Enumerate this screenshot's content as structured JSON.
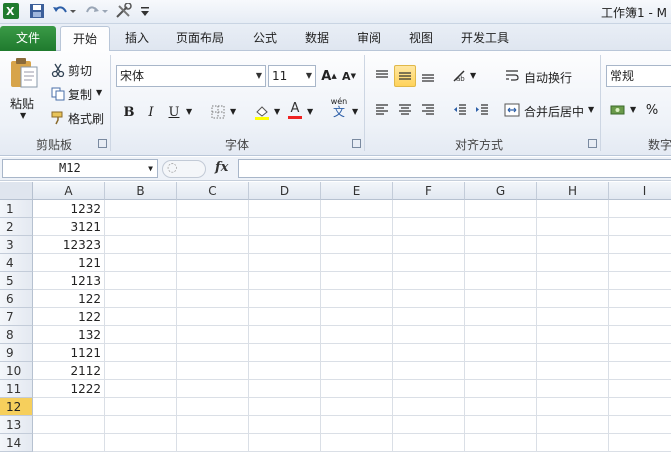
{
  "window": {
    "title": "工作簿1 - M"
  },
  "qat": {
    "icons": [
      "excel-logo-icon",
      "save-icon",
      "undo-icon",
      "redo-icon",
      "tools-icon",
      "customize-icon"
    ]
  },
  "tabs": [
    {
      "label": "文件"
    },
    {
      "label": "开始"
    },
    {
      "label": "插入"
    },
    {
      "label": "页面布局"
    },
    {
      "label": "公式"
    },
    {
      "label": "数据"
    },
    {
      "label": "审阅"
    },
    {
      "label": "视图"
    },
    {
      "label": "开发工具"
    }
  ],
  "clipboard": {
    "paste": "粘贴",
    "cut": "剪切",
    "copy": "复制",
    "format_painter": "格式刷",
    "group": "剪贴板"
  },
  "font": {
    "name": "宋体",
    "size": "11",
    "group": "字体",
    "phonetic": "wén"
  },
  "alignment": {
    "wrap": "自动换行",
    "merge": "合并后居中",
    "group": "对齐方式"
  },
  "number": {
    "format": "常规",
    "group": "数字",
    "percent": "%"
  },
  "formula_bar": {
    "name_box": "M12",
    "fx": "fx",
    "formula": ""
  },
  "sheet": {
    "columns": [
      "A",
      "B",
      "C",
      "D",
      "E",
      "F",
      "G",
      "H",
      "I"
    ],
    "rows": [
      "1",
      "2",
      "3",
      "4",
      "5",
      "6",
      "7",
      "8",
      "9",
      "10",
      "11",
      "12",
      "13",
      "14"
    ],
    "active_row": "12",
    "col_a_values": [
      "1232",
      "3121",
      "12323",
      "121",
      "1213",
      "122",
      "122",
      "132",
      "1121",
      "2112",
      "1222"
    ]
  },
  "colors": {
    "file_tab": "#2a8a3a",
    "highlight": "#ffd35a",
    "active_row": "#f6cf5c"
  }
}
